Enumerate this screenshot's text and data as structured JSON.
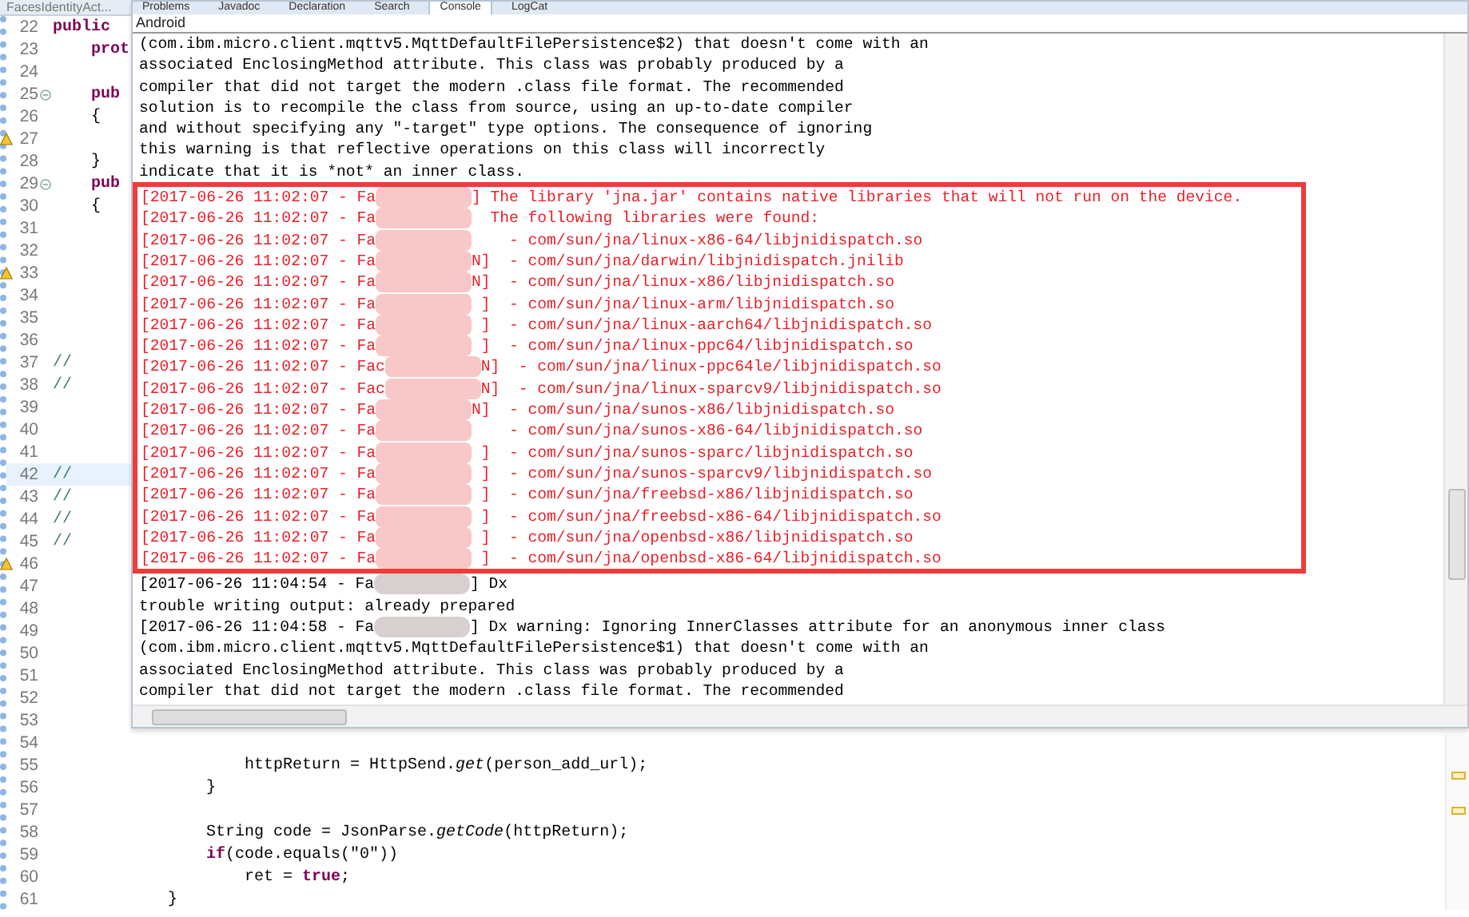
{
  "editor": {
    "tab": "FacesIdentityAct...",
    "lines": [
      {
        "number": "22",
        "text": "**public**",
        "kind": "code",
        "current": false,
        "warning": false,
        "collapsible": false
      },
      {
        "number": "23",
        "text": "    prot",
        "kind": "keyword",
        "current": false,
        "warning": false,
        "collapsible": false
      },
      {
        "number": "24",
        "current": false,
        "warning": false,
        "collapsible": false
      },
      {
        "number": "25",
        "text": "    pub",
        "kind": "keyword",
        "current": false,
        "warning": false,
        "collapsible": true
      },
      {
        "number": "26",
        "text": "    {",
        "kind": "code",
        "current": false,
        "warning": false,
        "collapsible": false
      },
      {
        "number": "27",
        "current": false,
        "warning": true,
        "collapsible": false
      },
      {
        "number": "28",
        "text": "    }",
        "kind": "code",
        "current": false,
        "warning": false,
        "collapsible": false
      },
      {
        "number": "29",
        "text": "    pub",
        "kind": "keyword",
        "current": false,
        "warning": false,
        "collapsible": true
      },
      {
        "number": "30",
        "text": "    {",
        "kind": "code",
        "current": false,
        "warning": false,
        "collapsible": false
      },
      {
        "number": "31",
        "current": false,
        "warning": false,
        "collapsible": false
      },
      {
        "number": "32",
        "current": false,
        "warning": false,
        "collapsible": false
      },
      {
        "number": "33",
        "current": false,
        "warning": true,
        "collapsible": false
      },
      {
        "number": "34",
        "current": false,
        "warning": false,
        "collapsible": false
      },
      {
        "number": "35",
        "current": false,
        "warning": false,
        "collapsible": false
      },
      {
        "number": "36",
        "current": false,
        "warning": false,
        "collapsible": false
      },
      {
        "number": "37",
        "text": "//",
        "kind": "comment",
        "current": false,
        "warning": false,
        "collapsible": false
      },
      {
        "number": "38",
        "text": "//",
        "kind": "comment",
        "current": false,
        "warning": false,
        "collapsible": false
      },
      {
        "number": "39",
        "current": false,
        "warning": false,
        "collapsible": false
      },
      {
        "number": "40",
        "current": false,
        "warning": false,
        "collapsible": false
      },
      {
        "number": "41",
        "current": false,
        "warning": false,
        "collapsible": false
      },
      {
        "number": "42",
        "text": "//",
        "kind": "comment",
        "current": true,
        "warning": false,
        "collapsible": false
      },
      {
        "number": "43",
        "text": "//",
        "kind": "comment",
        "current": false,
        "warning": false,
        "collapsible": false
      },
      {
        "number": "44",
        "text": "//",
        "kind": "comment",
        "current": false,
        "warning": false,
        "collapsible": false
      },
      {
        "number": "45",
        "text": "//",
        "kind": "comment",
        "current": false,
        "warning": false,
        "collapsible": false
      },
      {
        "number": "46",
        "current": false,
        "warning": true,
        "collapsible": false
      },
      {
        "number": "47",
        "current": false,
        "warning": false,
        "collapsible": false
      },
      {
        "number": "48",
        "current": false,
        "warning": false,
        "collapsible": false
      },
      {
        "number": "49",
        "current": false,
        "warning": false,
        "collapsible": false
      },
      {
        "number": "50",
        "current": false,
        "warning": false,
        "collapsible": false
      },
      {
        "number": "51",
        "current": false,
        "warning": false,
        "collapsible": false
      },
      {
        "number": "52",
        "current": false,
        "warning": false,
        "collapsible": false
      },
      {
        "number": "53",
        "current": false,
        "warning": false,
        "collapsible": false
      },
      {
        "number": "54",
        "current": false,
        "warning": false,
        "collapsible": false
      },
      {
        "number": "55",
        "text": "                    httpReturn = HttpSend.*get*(person_add_url);",
        "kind": "code",
        "current": false,
        "warning": false,
        "collapsible": false
      },
      {
        "number": "56",
        "text": "                }",
        "kind": "code",
        "current": false,
        "warning": false,
        "collapsible": false
      },
      {
        "number": "57",
        "current": false,
        "warning": false,
        "collapsible": false
      },
      {
        "number": "58",
        "text": "                String code = JsonParse.*getCode*(httpReturn);",
        "kind": "code",
        "current": false,
        "warning": false,
        "collapsible": false
      },
      {
        "number": "59",
        "text": "                **if**(code.equals(\"0\"))",
        "kind": "code",
        "current": false,
        "warning": false,
        "collapsible": false
      },
      {
        "number": "60",
        "text": "                    ret = **true**;",
        "kind": "code",
        "current": false,
        "warning": false,
        "collapsible": false
      },
      {
        "number": "61",
        "text": "            }",
        "kind": "code",
        "current": false,
        "warning": false,
        "collapsible": false
      }
    ]
  },
  "console": {
    "tabs": [
      {
        "label": "Problems",
        "selected": false
      },
      {
        "label": "Javadoc",
        "selected": false
      },
      {
        "label": "Declaration",
        "selected": false
      },
      {
        "label": "Search",
        "selected": false
      },
      {
        "label": "Console",
        "selected": true
      },
      {
        "label": "LogCat",
        "selected": false
      }
    ],
    "title": "Android",
    "before": [
      "(com.ibm.micro.client.mqttv5.MqttDefaultFilePersistence$2) that doesn't come with an",
      "associated EnclosingMethod attribute. This class was probably produced by a",
      "compiler that did not target the modern .class file format. The recommended",
      "solution is to recompile the class from source, using an up-to-date compiler",
      "and without specifying any \"-target\" type options. The consequence of ignoring",
      "this warning is that reflective operations on this class will incorrectly",
      "indicate that it is *not* an inner class."
    ],
    "highlighted": [
      {
        "prefix": "[2017-06-26 11:02:07 - Fa",
        "suffix": "] The library 'jna.jar' contains native libraries that will not run on the device."
      },
      {
        "prefix": "[2017-06-26 11:02:07 - Fa",
        "suffix": "  The following libraries were found:"
      },
      {
        "prefix": "[2017-06-26 11:02:07 - Fa",
        "suffix": "    - com/sun/jna/linux-x86-64/libjnidispatch.so"
      },
      {
        "prefix": "[2017-06-26 11:02:07 - Fa",
        "suffix": "N]  - com/sun/jna/darwin/libjnidispatch.jnilib"
      },
      {
        "prefix": "[2017-06-26 11:02:07 - Fa",
        "suffix": "N]  - com/sun/jna/linux-x86/libjnidispatch.so"
      },
      {
        "prefix": "[2017-06-26 11:02:07 - Fa",
        "suffix": " ]  - com/sun/jna/linux-arm/libjnidispatch.so"
      },
      {
        "prefix": "[2017-06-26 11:02:07 - Fa",
        "suffix": " ]  - com/sun/jna/linux-aarch64/libjnidispatch.so"
      },
      {
        "prefix": "[2017-06-26 11:02:07 - Fa",
        "suffix": " ]  - com/sun/jna/linux-ppc64/libjnidispatch.so"
      },
      {
        "prefix": "[2017-06-26 11:02:07 - Fac",
        "suffix": "N]  - com/sun/jna/linux-ppc64le/libjnidispatch.so"
      },
      {
        "prefix": "[2017-06-26 11:02:07 - Fac",
        "suffix": "N]  - com/sun/jna/linux-sparcv9/libjnidispatch.so"
      },
      {
        "prefix": "[2017-06-26 11:02:07 - Fa",
        "suffix": "N]  - com/sun/jna/sunos-x86/libjnidispatch.so"
      },
      {
        "prefix": "[2017-06-26 11:02:07 - Fa",
        "suffix": "    - com/sun/jna/sunos-x86-64/libjnidispatch.so"
      },
      {
        "prefix": "[2017-06-26 11:02:07 - Fa",
        "suffix": " ]  - com/sun/jna/sunos-sparc/libjnidispatch.so"
      },
      {
        "prefix": "[2017-06-26 11:02:07 - Fa",
        "suffix": " ]  - com/sun/jna/sunos-sparcv9/libjnidispatch.so"
      },
      {
        "prefix": "[2017-06-26 11:02:07 - Fa",
        "suffix": " ]  - com/sun/jna/freebsd-x86/libjnidispatch.so"
      },
      {
        "prefix": "[2017-06-26 11:02:07 - Fa",
        "suffix": " ]  - com/sun/jna/freebsd-x86-64/libjnidispatch.so"
      },
      {
        "prefix": "[2017-06-26 11:02:07 - Fa",
        "suffix": " ]  - com/sun/jna/openbsd-x86/libjnidispatch.so"
      },
      {
        "prefix": "[2017-06-26 11:02:07 - Fa",
        "suffix": " ]  - com/sun/jna/openbsd-x86-64/libjnidispatch.so"
      }
    ],
    "after": [
      {
        "kind": "log",
        "prefix": "[2017-06-26 11:04:54 - Fa",
        "suffix": "] Dx"
      },
      {
        "kind": "plain",
        "text": "trouble writing output: already prepared"
      },
      {
        "kind": "log",
        "prefix": "[2017-06-26 11:04:58 - Fa",
        "suffix": "] Dx warning: Ignoring InnerClasses attribute for an anonymous inner class"
      },
      {
        "kind": "plain",
        "text": "(com.ibm.micro.client.mqttv5.MqttDefaultFilePersistence$1) that doesn't come with an"
      },
      {
        "kind": "plain",
        "text": "associated EnclosingMethod attribute. This class was probably produced by a"
      },
      {
        "kind": "plain",
        "text": "compiler that did not target the modern .class file format. The recommended"
      }
    ]
  }
}
